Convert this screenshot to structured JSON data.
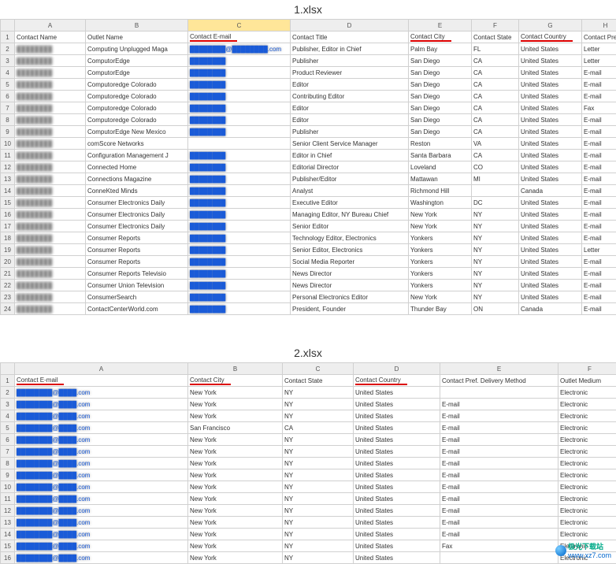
{
  "file1": {
    "title": "1.xlsx",
    "cols": [
      "",
      "A",
      "B",
      "C",
      "D",
      "E",
      "F",
      "G",
      "H"
    ],
    "headers": [
      "Contact Name",
      "Outlet Name",
      "Contact E-mail",
      "Contact Title",
      "Contact City",
      "Contact State",
      "Contact Country",
      "Contact Pref. D"
    ],
    "rows": [
      {
        "n": "2",
        "name": "████████",
        "outlet": "Computing Unplugged Maga",
        "email": "████████@████████.com",
        "title": "Publisher, Editor in Chief",
        "city": "Palm Bay",
        "state": "FL",
        "country": "United States",
        "pref": "Letter"
      },
      {
        "n": "3",
        "name": "████████",
        "outlet": "ComputorEdge",
        "email": "████████",
        "title": "Publisher",
        "city": "San Diego",
        "state": "CA",
        "country": "United States",
        "pref": "Letter"
      },
      {
        "n": "4",
        "name": "████████",
        "outlet": "ComputorEdge",
        "email": "████████",
        "title": "Product Reviewer",
        "city": "San Diego",
        "state": "CA",
        "country": "United States",
        "pref": "E-mail"
      },
      {
        "n": "5",
        "name": "████████",
        "outlet": "Computoredge Colorado",
        "email": "████████",
        "title": "Editor",
        "city": "San Diego",
        "state": "CA",
        "country": "United States",
        "pref": "E-mail"
      },
      {
        "n": "6",
        "name": "████████",
        "outlet": "Computoredge Colorado",
        "email": "████████",
        "title": "Contributing Editor",
        "city": "San Diego",
        "state": "CA",
        "country": "United States",
        "pref": "E-mail"
      },
      {
        "n": "7",
        "name": "████████",
        "outlet": "Computoredge Colorado",
        "email": "████████",
        "title": "Editor",
        "city": "San Diego",
        "state": "CA",
        "country": "United States",
        "pref": "Fax"
      },
      {
        "n": "8",
        "name": "████████",
        "outlet": "Computoredge Colorado",
        "email": "████████",
        "title": "Editor",
        "city": "San Diego",
        "state": "CA",
        "country": "United States",
        "pref": "E-mail"
      },
      {
        "n": "9",
        "name": "████████",
        "outlet": "ComputorEdge New Mexico",
        "email": "████████",
        "title": "Publisher",
        "city": "San Diego",
        "state": "CA",
        "country": "United States",
        "pref": "E-mail"
      },
      {
        "n": "10",
        "name": "████████",
        "outlet": "comScore Networks",
        "email": "",
        "title": "Senior Client Service Manager",
        "city": "Reston",
        "state": "VA",
        "country": "United States",
        "pref": "E-mail"
      },
      {
        "n": "11",
        "name": "████████",
        "outlet": "Configuration Management J",
        "email": "████████",
        "title": "Editor in Chief",
        "city": "Santa Barbara",
        "state": "CA",
        "country": "United States",
        "pref": "E-mail"
      },
      {
        "n": "12",
        "name": "████████",
        "outlet": "Connected Home",
        "email": "████████",
        "title": "Editorial Director",
        "city": "Loveland",
        "state": "CO",
        "country": "United States",
        "pref": "E-mail"
      },
      {
        "n": "13",
        "name": "████████",
        "outlet": "Connections Magazine",
        "email": "████████",
        "title": "Publisher/Editor",
        "city": "Mattawan",
        "state": "MI",
        "country": "United States",
        "pref": "E-mail"
      },
      {
        "n": "14",
        "name": "████████",
        "outlet": "ConneKted Minds",
        "email": "████████",
        "title": "Analyst",
        "city": "Richmond Hill",
        "state": "",
        "country": "Canada",
        "pref": "E-mail"
      },
      {
        "n": "15",
        "name": "████████",
        "outlet": "Consumer Electronics Daily",
        "email": "████████",
        "title": "Executive Editor",
        "city": "Washington",
        "state": "DC",
        "country": "United States",
        "pref": "E-mail"
      },
      {
        "n": "16",
        "name": "████████",
        "outlet": "Consumer Electronics Daily",
        "email": "████████",
        "title": "Managing Editor, NY Bureau Chief",
        "city": "New York",
        "state": "NY",
        "country": "United States",
        "pref": "E-mail"
      },
      {
        "n": "17",
        "name": "████████",
        "outlet": "Consumer Electronics Daily",
        "email": "████████",
        "title": "Senior Editor",
        "city": "New York",
        "state": "NY",
        "country": "United States",
        "pref": "E-mail"
      },
      {
        "n": "18",
        "name": "████████",
        "outlet": "Consumer Reports",
        "email": "████████",
        "title": "Technology Editor, Electronics",
        "city": "Yonkers",
        "state": "NY",
        "country": "United States",
        "pref": "E-mail"
      },
      {
        "n": "19",
        "name": "████████",
        "outlet": "Consumer Reports",
        "email": "████████",
        "title": "Senior Editor, Electronics",
        "city": "Yonkers",
        "state": "NY",
        "country": "United States",
        "pref": "Letter"
      },
      {
        "n": "20",
        "name": "████████",
        "outlet": "Consumer Reports",
        "email": "████████",
        "title": "Social Media Reporter",
        "city": "Yonkers",
        "state": "NY",
        "country": "United States",
        "pref": "E-mail"
      },
      {
        "n": "21",
        "name": "████████",
        "outlet": "Consumer Reports Televisio",
        "email": "████████",
        "title": "News Director",
        "city": "Yonkers",
        "state": "NY",
        "country": "United States",
        "pref": "E-mail"
      },
      {
        "n": "22",
        "name": "████████",
        "outlet": "Consumer Union Television",
        "email": "████████",
        "title": "News Director",
        "city": "Yonkers",
        "state": "NY",
        "country": "United States",
        "pref": "E-mail"
      },
      {
        "n": "23",
        "name": "████████",
        "outlet": "ConsumerSearch",
        "email": "████████",
        "title": "Personal Electronics Editor",
        "city": "New York",
        "state": "NY",
        "country": "United States",
        "pref": "E-mail"
      },
      {
        "n": "24",
        "name": "████████",
        "outlet": "ContactCenterWorld.com",
        "email": "████████",
        "title": "President, Founder",
        "city": "Thunder Bay",
        "state": "ON",
        "country": "Canada",
        "pref": "E-mail"
      }
    ]
  },
  "file2": {
    "title": "2.xlsx",
    "cols": [
      "",
      "A",
      "B",
      "C",
      "D",
      "E",
      "F"
    ],
    "headers": [
      "Contact E-mail",
      "Contact City",
      "Contact State",
      "Contact Country",
      "Contact Pref. Delivery Method",
      "Outlet Medium"
    ],
    "rows": [
      {
        "n": "2",
        "email": "████████@████.com",
        "city": "New York",
        "state": "NY",
        "country": "United States",
        "pref": "",
        "medium": "Electronic"
      },
      {
        "n": "3",
        "email": "████████@████.com",
        "city": "New York",
        "state": "NY",
        "country": "United States",
        "pref": "E-mail",
        "medium": "Electronic"
      },
      {
        "n": "4",
        "email": "████████@████.com",
        "city": "New York",
        "state": "NY",
        "country": "United States",
        "pref": "E-mail",
        "medium": "Electronic"
      },
      {
        "n": "5",
        "email": "████████@████.com",
        "city": "San Francisco",
        "state": "CA",
        "country": "United States",
        "pref": "E-mail",
        "medium": "Electronic"
      },
      {
        "n": "6",
        "email": "████████@████.com",
        "city": "New York",
        "state": "NY",
        "country": "United States",
        "pref": "E-mail",
        "medium": "Electronic"
      },
      {
        "n": "7",
        "email": "████████@████.com",
        "city": "New York",
        "state": "NY",
        "country": "United States",
        "pref": "E-mail",
        "medium": "Electronic"
      },
      {
        "n": "8",
        "email": "████████@████.com",
        "city": "New York",
        "state": "NY",
        "country": "United States",
        "pref": "E-mail",
        "medium": "Electronic"
      },
      {
        "n": "9",
        "email": "████████@████.com",
        "city": "New York",
        "state": "NY",
        "country": "United States",
        "pref": "E-mail",
        "medium": "Electronic"
      },
      {
        "n": "10",
        "email": "████████@████.com",
        "city": "New York",
        "state": "NY",
        "country": "United States",
        "pref": "E-mail",
        "medium": "Electronic"
      },
      {
        "n": "11",
        "email": "████████@████.com",
        "city": "New York",
        "state": "NY",
        "country": "United States",
        "pref": "E-mail",
        "medium": "Electronic"
      },
      {
        "n": "12",
        "email": "████████@████.com",
        "city": "New York",
        "state": "NY",
        "country": "United States",
        "pref": "E-mail",
        "medium": "Electronic"
      },
      {
        "n": "13",
        "email": "████████@████.com",
        "city": "New York",
        "state": "NY",
        "country": "United States",
        "pref": "E-mail",
        "medium": "Electronic"
      },
      {
        "n": "14",
        "email": "████████@████.com",
        "city": "New York",
        "state": "NY",
        "country": "United States",
        "pref": "E-mail",
        "medium": "Electronic"
      },
      {
        "n": "15",
        "email": "████████@████.com",
        "city": "New York",
        "state": "NY",
        "country": "United States",
        "pref": "Fax",
        "medium": "Electronic"
      },
      {
        "n": "16",
        "email": "████████@████.com",
        "city": "New York",
        "state": "NY",
        "country": "United States",
        "pref": "",
        "medium": "Electronic"
      }
    ]
  },
  "watermark": {
    "brand": "极光下载站",
    "url": "www.xz7.com"
  }
}
